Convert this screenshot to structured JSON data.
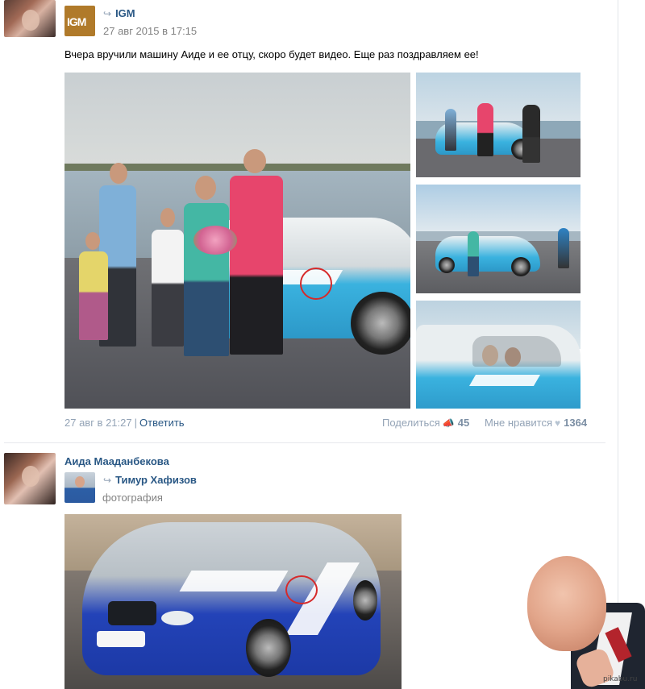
{
  "post1": {
    "group_name": "IGM",
    "group_logo_text": "IGM",
    "date": "27 авг 2015 в 17:15",
    "text": "Вчера вручили машину Аиде и ее отцу, скоро будет видео. Еще раз поздравляем ее!",
    "footer": {
      "date": "27 авг в 21:27",
      "separator": "|",
      "reply_label": "Ответить",
      "share_label": "Поделиться",
      "share_count": "45",
      "like_label": "Мне нравится",
      "like_count": "1364"
    }
  },
  "post2": {
    "author_name": "Аида Мааданбекова",
    "reposted_name": "Тимур Хафизов",
    "subtitle": "фотография"
  },
  "icons": {
    "repost": "repost-arrow-icon",
    "share": "megaphone-icon",
    "like": "heart-icon"
  },
  "colors": {
    "link": "#2a5885",
    "muted": "#828282",
    "footer_muted": "#93a3b6",
    "annotation": "#d62a2a"
  },
  "watermark": "pikabu.ru"
}
